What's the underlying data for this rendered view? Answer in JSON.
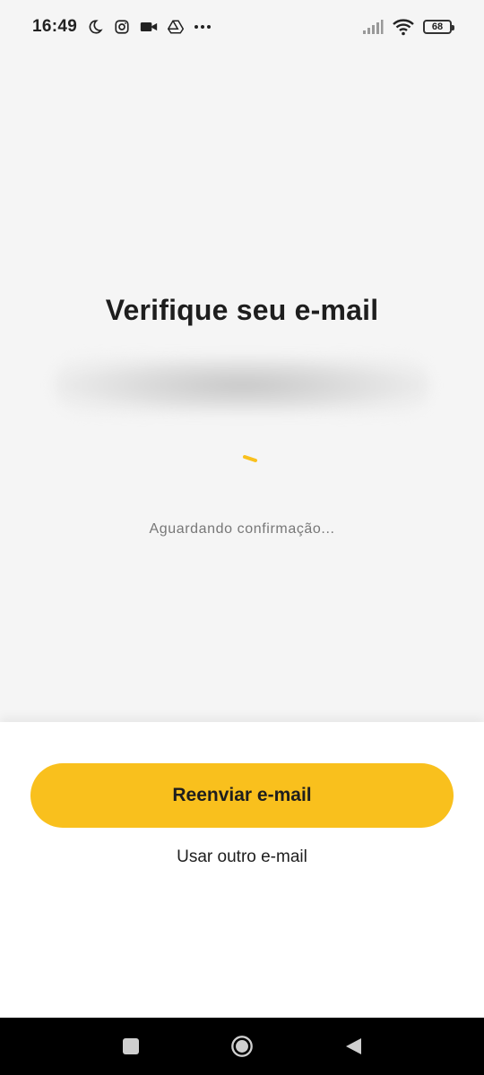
{
  "status_bar": {
    "time": "16:49",
    "battery_level": "68",
    "icons_left": [
      "moon-icon",
      "instagram-icon",
      "video-camera-icon",
      "drive-icon",
      "more-dots-icon"
    ],
    "icons_right": [
      "signal-icon",
      "wifi-icon",
      "battery-icon"
    ]
  },
  "main": {
    "title": "Verifique seu e-mail",
    "waiting_text": "Aguardando confirmação...",
    "spinner_color": "#f9c01d"
  },
  "bottom_sheet": {
    "primary_button_label": "Reenviar e-mail",
    "secondary_link_label": "Usar outro e-mail",
    "accent_color": "#f9c01d"
  },
  "nav_bar": {
    "buttons": [
      "recents-square-icon",
      "home-circle-icon",
      "back-triangle-icon"
    ]
  }
}
